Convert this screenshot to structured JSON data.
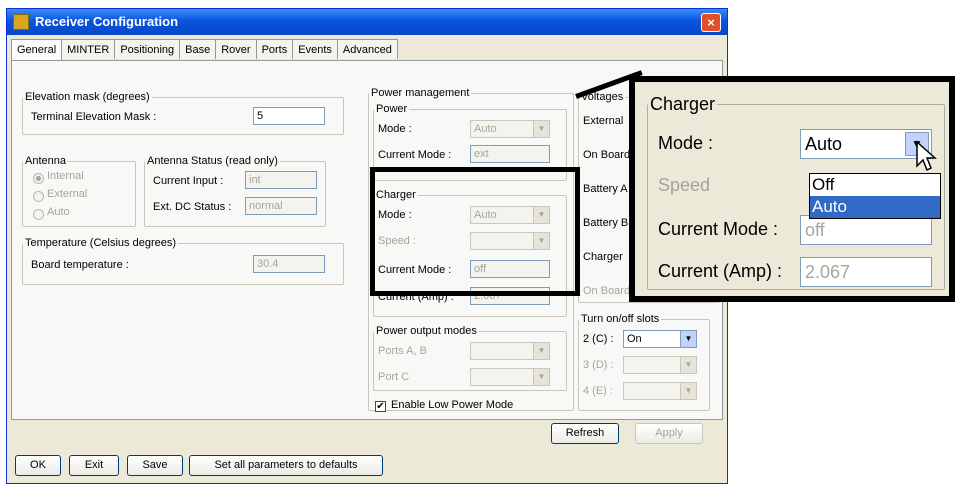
{
  "window": {
    "title": "Receiver Configuration",
    "close_label": "×"
  },
  "tabs": [
    "General",
    "MINTER",
    "Positioning",
    "Base",
    "Rover",
    "Ports",
    "Events",
    "Advanced"
  ],
  "elevation": {
    "legend": "Elevation mask (degrees)",
    "label": "Terminal Elevation Mask :",
    "value": "5"
  },
  "antenna": {
    "legend": "Antenna",
    "options": [
      "Internal",
      "External",
      "Auto"
    ],
    "selected": "Internal"
  },
  "antenna_status": {
    "legend": "Antenna Status (read only)",
    "current_input_label": "Current Input :",
    "current_input_value": "int",
    "ext_dc_label": "Ext. DC Status :",
    "ext_dc_value": "normal"
  },
  "temperature": {
    "legend": "Temperature (Celsius degrees)",
    "label": "Board temperature :",
    "value": "30.4"
  },
  "power_management": {
    "legend": "Power management",
    "power": {
      "legend": "Power",
      "mode_label": "Mode :",
      "mode_value": "Auto",
      "current_mode_label": "Current Mode :",
      "current_mode_value": "ext"
    },
    "charger": {
      "legend": "Charger",
      "mode_label": "Mode :",
      "mode_value": "Auto",
      "speed_label": "Speed :",
      "current_mode_label": "Current Mode :",
      "current_mode_value": "off",
      "current_label": "Current (Amp) :",
      "current_value": "2.067"
    }
  },
  "voltages": {
    "legend": "Voltages",
    "rows": [
      "External",
      "On Board",
      "Battery A",
      "Battery B",
      "Charger",
      "On Board"
    ]
  },
  "power_output": {
    "legend": "Power output modes",
    "row1": "Ports A, B",
    "row2": "Port C"
  },
  "low_power": {
    "label": "Enable Low Power Mode",
    "checked": true
  },
  "turn_on": {
    "legend": "Turn on/off slots",
    "rows": [
      {
        "label": "2 (C) :",
        "value": "On"
      },
      {
        "label": "3 (D) :",
        "value": ""
      },
      {
        "label": "4 (E) :",
        "value": ""
      }
    ]
  },
  "buttons": {
    "refresh": "Refresh",
    "apply": "Apply",
    "ok": "OK",
    "exit": "Exit",
    "save": "Save",
    "defaults": "Set all parameters to defaults"
  },
  "zoom": {
    "legend": "Charger",
    "mode_label": "Mode :",
    "mode_value": "Auto",
    "speed_label": "Speed",
    "current_mode_label": "Current Mode :",
    "current_mode_value": "off",
    "current_label": "Current (Amp) :",
    "current_value": "2.067",
    "options": [
      "Off",
      "Auto"
    ],
    "selected_option": "Auto"
  },
  "colors": {
    "titlebar": "#0a55e0",
    "selection": "#316ac5",
    "highlight_border": "#000000"
  }
}
